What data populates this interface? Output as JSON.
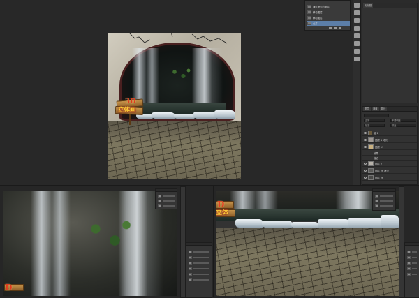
{
  "history": {
    "items": [
      {
        "label": "通过拷贝的图层"
      },
      {
        "label": "移动图层"
      },
      {
        "label": "移动图层"
      },
      {
        "label": "合并",
        "selected": true
      }
    ]
  },
  "panel2": {
    "tab": "无标题"
  },
  "layers": {
    "tabs": [
      "图层",
      "通道",
      "路径"
    ],
    "mode": "正常",
    "opacity_label": "不透明度",
    "lock_label": "锁定",
    "fill_label": "填充",
    "rows": [
      {
        "name": "组 1",
        "kind": "group"
      },
      {
        "name": "图层 4 拷贝",
        "kind": "layer"
      },
      {
        "name": "图层 11",
        "kind": "layer"
      },
      {
        "name": "效果",
        "kind": "fx"
      },
      {
        "name": "描边",
        "kind": "fx"
      },
      {
        "name": "图层 2",
        "kind": "layer"
      },
      {
        "name": "图层 26 拷贝",
        "kind": "layer"
      },
      {
        "name": "图层 26",
        "kind": "layer"
      }
    ]
  },
  "sign": {
    "top_text": "3D",
    "bottom_text": "立体画",
    "crop_left": "D",
    "crop_left2": "立体",
    "crop_right": "D",
    "crop_right2": "立体"
  },
  "colors": {
    "workspace": "#282828",
    "panel": "#323232",
    "history_selected": "#5c7ea8"
  }
}
